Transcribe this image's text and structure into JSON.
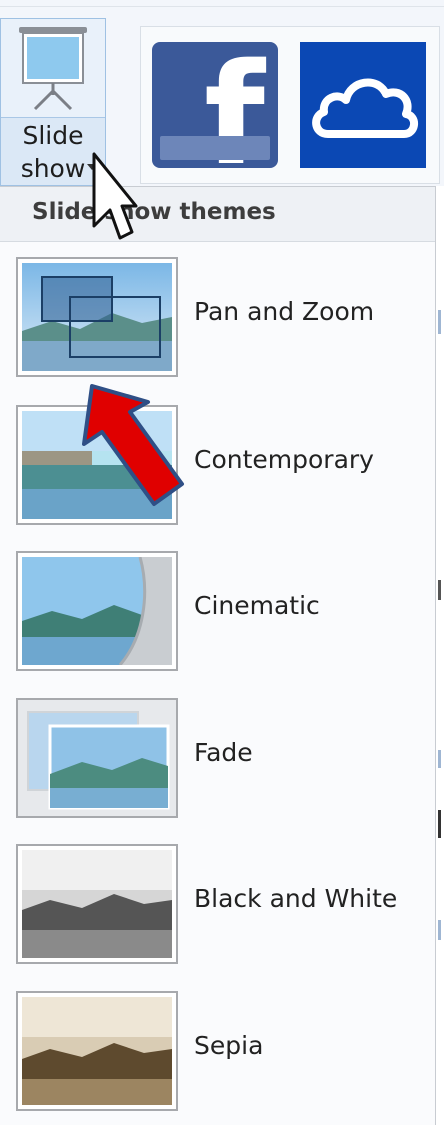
{
  "ribbon": {
    "slideshow_label_line1": "Slide",
    "slideshow_label_line2": "show",
    "share_icons": [
      "facebook-icon",
      "onedrive-icon"
    ],
    "colors": {
      "facebook": "#3b5999",
      "onedrive": "#0b48b4",
      "button_hover": "#dbe8f6"
    }
  },
  "menu": {
    "header": "Slide show themes",
    "items": [
      {
        "label": "Pan and Zoom"
      },
      {
        "label": "Contemporary"
      },
      {
        "label": "Cinematic"
      },
      {
        "label": "Fade"
      },
      {
        "label": "Black and White"
      },
      {
        "label": "Sepia"
      }
    ]
  },
  "annotations": {
    "pointer_color": "#e00000"
  }
}
